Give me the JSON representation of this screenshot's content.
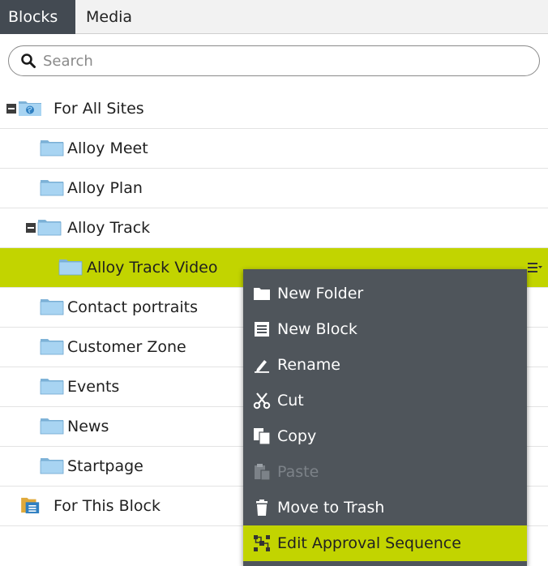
{
  "tabs": [
    {
      "label": "Blocks",
      "active": true
    },
    {
      "label": "Media",
      "active": false
    }
  ],
  "search": {
    "placeholder": "Search",
    "value": ""
  },
  "tree": {
    "items": [
      {
        "label": "For All Sites"
      },
      {
        "label": "Alloy Meet"
      },
      {
        "label": "Alloy Plan"
      },
      {
        "label": "Alloy Track"
      },
      {
        "label": "Alloy Track Video"
      },
      {
        "label": "Contact portraits"
      },
      {
        "label": "Customer Zone"
      },
      {
        "label": "Events"
      },
      {
        "label": "News"
      },
      {
        "label": "Startpage"
      },
      {
        "label": "For This Block"
      }
    ]
  },
  "context_menu": {
    "items": [
      {
        "label": "New Folder",
        "icon": "folder-icon"
      },
      {
        "label": "New Block",
        "icon": "block-icon"
      },
      {
        "label": "Rename",
        "icon": "rename-icon"
      },
      {
        "label": "Cut",
        "icon": "scissors-icon"
      },
      {
        "label": "Copy",
        "icon": "copy-icon"
      },
      {
        "label": "Paste",
        "icon": "paste-icon",
        "disabled": true
      },
      {
        "label": "Move to Trash",
        "icon": "trash-icon"
      },
      {
        "label": "Edit Approval Sequence",
        "icon": "approval-sequence-icon",
        "highlighted": true
      }
    ]
  },
  "colors": {
    "accent": "#c2d400",
    "menu_bg": "#4f555b",
    "tab_active_bg": "#434a52",
    "folder": "#a8d4f2"
  }
}
